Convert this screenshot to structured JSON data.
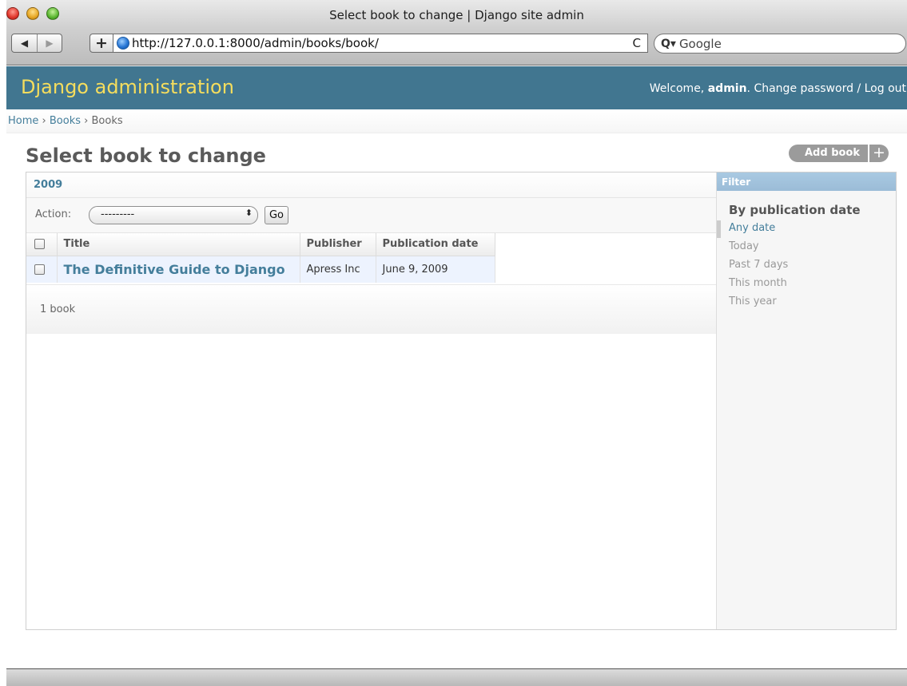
{
  "browser": {
    "window_title": "Select book to change | Django site admin",
    "url": "http://127.0.0.1:8000/admin/books/book/",
    "search_placeholder": "Google",
    "back_label": "◀",
    "forward_label": "▶",
    "newtab_label": "+",
    "reload_label": "C",
    "search_glyph": "Q▾"
  },
  "header": {
    "branding": "Django administration",
    "welcome": "Welcome,",
    "username": "admin",
    "welcome_suffix": ".",
    "change_password": "Change password",
    "separator": "/",
    "logout": "Log out"
  },
  "breadcrumbs": {
    "home": "Home",
    "sep1": "›",
    "app": "Books",
    "sep2": "›",
    "current": "Books"
  },
  "page": {
    "title": "Select book to change",
    "add_label": "Add book",
    "add_plus": "+"
  },
  "date_hierarchy": {
    "year": "2009"
  },
  "actions": {
    "label": "Action:",
    "selected": "---------",
    "arrows": "⬍",
    "go": "Go"
  },
  "table": {
    "columns": [
      "Title",
      "Publisher",
      "Publication date"
    ],
    "rows": [
      {
        "title": "The Definitive Guide to Django",
        "publisher": "Apress Inc",
        "date": "June 9, 2009"
      }
    ]
  },
  "paginator": {
    "count": "1 book"
  },
  "filter": {
    "heading": "Filter",
    "section": "By publication date",
    "options": [
      "Any date",
      "Today",
      "Past 7 days",
      "This month",
      "This year"
    ],
    "selected_index": 0
  },
  "colors": {
    "header_bg": "#417690",
    "branding": "#f5dd5d",
    "link": "#447e9b",
    "row_bg": "#edf3fe",
    "filter_head": "#9bbcd7"
  }
}
